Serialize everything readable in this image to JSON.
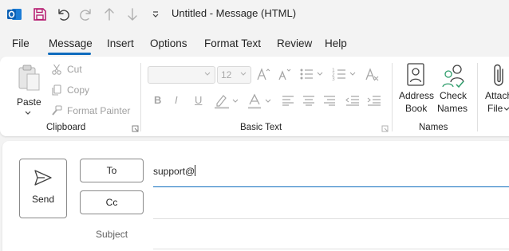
{
  "window": {
    "title": "Untitled  -  Message (HTML)",
    "accent_color": "#0f6cbd"
  },
  "quick_access": [
    {
      "icon": "outlook-logo-icon"
    },
    {
      "icon": "save-icon"
    },
    {
      "icon": "undo-icon"
    },
    {
      "icon": "redo-icon"
    },
    {
      "icon": "previous-item-icon"
    },
    {
      "icon": "next-item-icon"
    },
    {
      "icon": "customize-dropdown-icon"
    }
  ],
  "menu": {
    "tabs": [
      "File",
      "Message",
      "Insert",
      "Options",
      "Format Text",
      "Review",
      "Help"
    ],
    "active": "Message"
  },
  "ribbon": {
    "clipboard": {
      "paste": "Paste",
      "cut": "Cut",
      "copy": "Copy",
      "format_painter": "Format Painter",
      "group_label": "Clipboard"
    },
    "basic_text": {
      "font_name": "",
      "font_size": "12",
      "group_label": "Basic Text",
      "format_buttons": [
        "B",
        "I",
        "U"
      ]
    },
    "names": {
      "address_book_line1": "Address",
      "address_book_line2": "Book",
      "check_names_line1": "Check",
      "check_names_line2": "Names",
      "group_label": "Names"
    },
    "attach": {
      "line1": "Attach",
      "line2": "File"
    }
  },
  "compose": {
    "send_label": "Send",
    "to_label": "To",
    "cc_label": "Cc",
    "to_value": "support@",
    "cc_value": "",
    "subject_label": "Subject",
    "subject_value": ""
  }
}
